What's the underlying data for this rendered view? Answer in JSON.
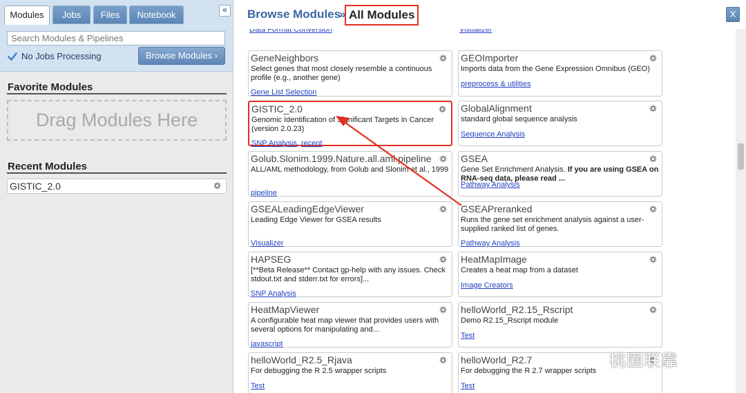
{
  "sidebar": {
    "tabs": [
      "Modules",
      "Jobs",
      "Files",
      "Notebook"
    ],
    "collapse_icon": "double-chevron-left-icon",
    "collapse_glyph": "«",
    "search_placeholder": "Search Modules & Pipelines",
    "jobs_status": "No Jobs Processing",
    "browse_button": "Browse Modules ›",
    "favorites_title": "Favorite Modules",
    "dropzone_text": "Drag Modules Here",
    "recent_title": "Recent Modules",
    "recent_items": [
      "GISTIC_2.0"
    ]
  },
  "main": {
    "breadcrumb_browse": "Browse Modules",
    "breadcrumb_sep": "»",
    "breadcrumb_current": "All Modules",
    "close_label": "X",
    "partial_top": [
      "Data Format Conversion",
      "Visualizer"
    ],
    "modules": [
      {
        "name": "GeneNeighbors",
        "desc": "Select genes that most closely resemble a continuous profile (e.g., another gene)",
        "cats": [
          "Gene List Selection"
        ]
      },
      {
        "name": "GEOImporter",
        "desc": "Imports data from the Gene Expression Omnibus (GEO)",
        "cats": [
          "preprocess & utilities"
        ]
      },
      {
        "name": "GISTIC_2.0",
        "desc": "Genomic Identification of Significant Targets in Cancer (version 2.0.23)",
        "cats": [
          "SNP Analysis",
          "recent"
        ]
      },
      {
        "name": "GlobalAlignment",
        "desc": "standard global sequence analysis",
        "cats": [
          "Sequence Analysis"
        ]
      },
      {
        "name": "Golub.Slonim.1999.Nature.all.aml.pipeline",
        "desc": "ALL/AML methodology, from Golub and Slonim et al., 1999",
        "cats": [
          "pipeline"
        ]
      },
      {
        "name": "GSEA",
        "desc": "Gene Set Enrichment Analysis. ",
        "desc_bold": "If you are using GSEA on RNA-seq data, please read ...",
        "cats": [
          "Pathway Analysis"
        ]
      },
      {
        "name": "GSEALeadingEdgeViewer",
        "desc": "Leading Edge Viewer for GSEA results",
        "cats": [
          "Visualizer"
        ]
      },
      {
        "name": "GSEAPreranked",
        "desc": "Runs the gene set enrichment analysis against a user-supplied ranked list of genes.",
        "cats": [
          "Pathway Analysis"
        ]
      },
      {
        "name": "HAPSEG",
        "desc": "[**Beta Release** Contact gp-help with any issues. Check stdout.txt and stderr.txt for errors]...",
        "cats": [
          "SNP Analysis"
        ]
      },
      {
        "name": "HeatMapImage",
        "desc": "Creates a heat map from a dataset",
        "cats": [
          "Image Creators"
        ]
      },
      {
        "name": "HeatMapViewer",
        "desc": "A configurable heat map viewer that provides users with several options for manipulating and...",
        "cats": [
          "javascript"
        ]
      },
      {
        "name": "helloWorld_R2.15_Rscript",
        "desc": "Demo R2.15_Rscript module",
        "cats": [
          "Test"
        ]
      },
      {
        "name": "helloWorld_R2.5_Rjava",
        "desc": "For debugging the R 2.5 wrapper scripts",
        "cats": [
          "Test"
        ]
      },
      {
        "name": "helloWorld_R2.7",
        "desc": "For debugging the R 2.7 wrapper scripts",
        "cats": [
          "Test"
        ]
      }
    ]
  },
  "watermark": "桃圈联靠",
  "colors": {
    "accent": "#3a67a6",
    "highlight": "#e0301e",
    "link": "#1f3fbf"
  }
}
